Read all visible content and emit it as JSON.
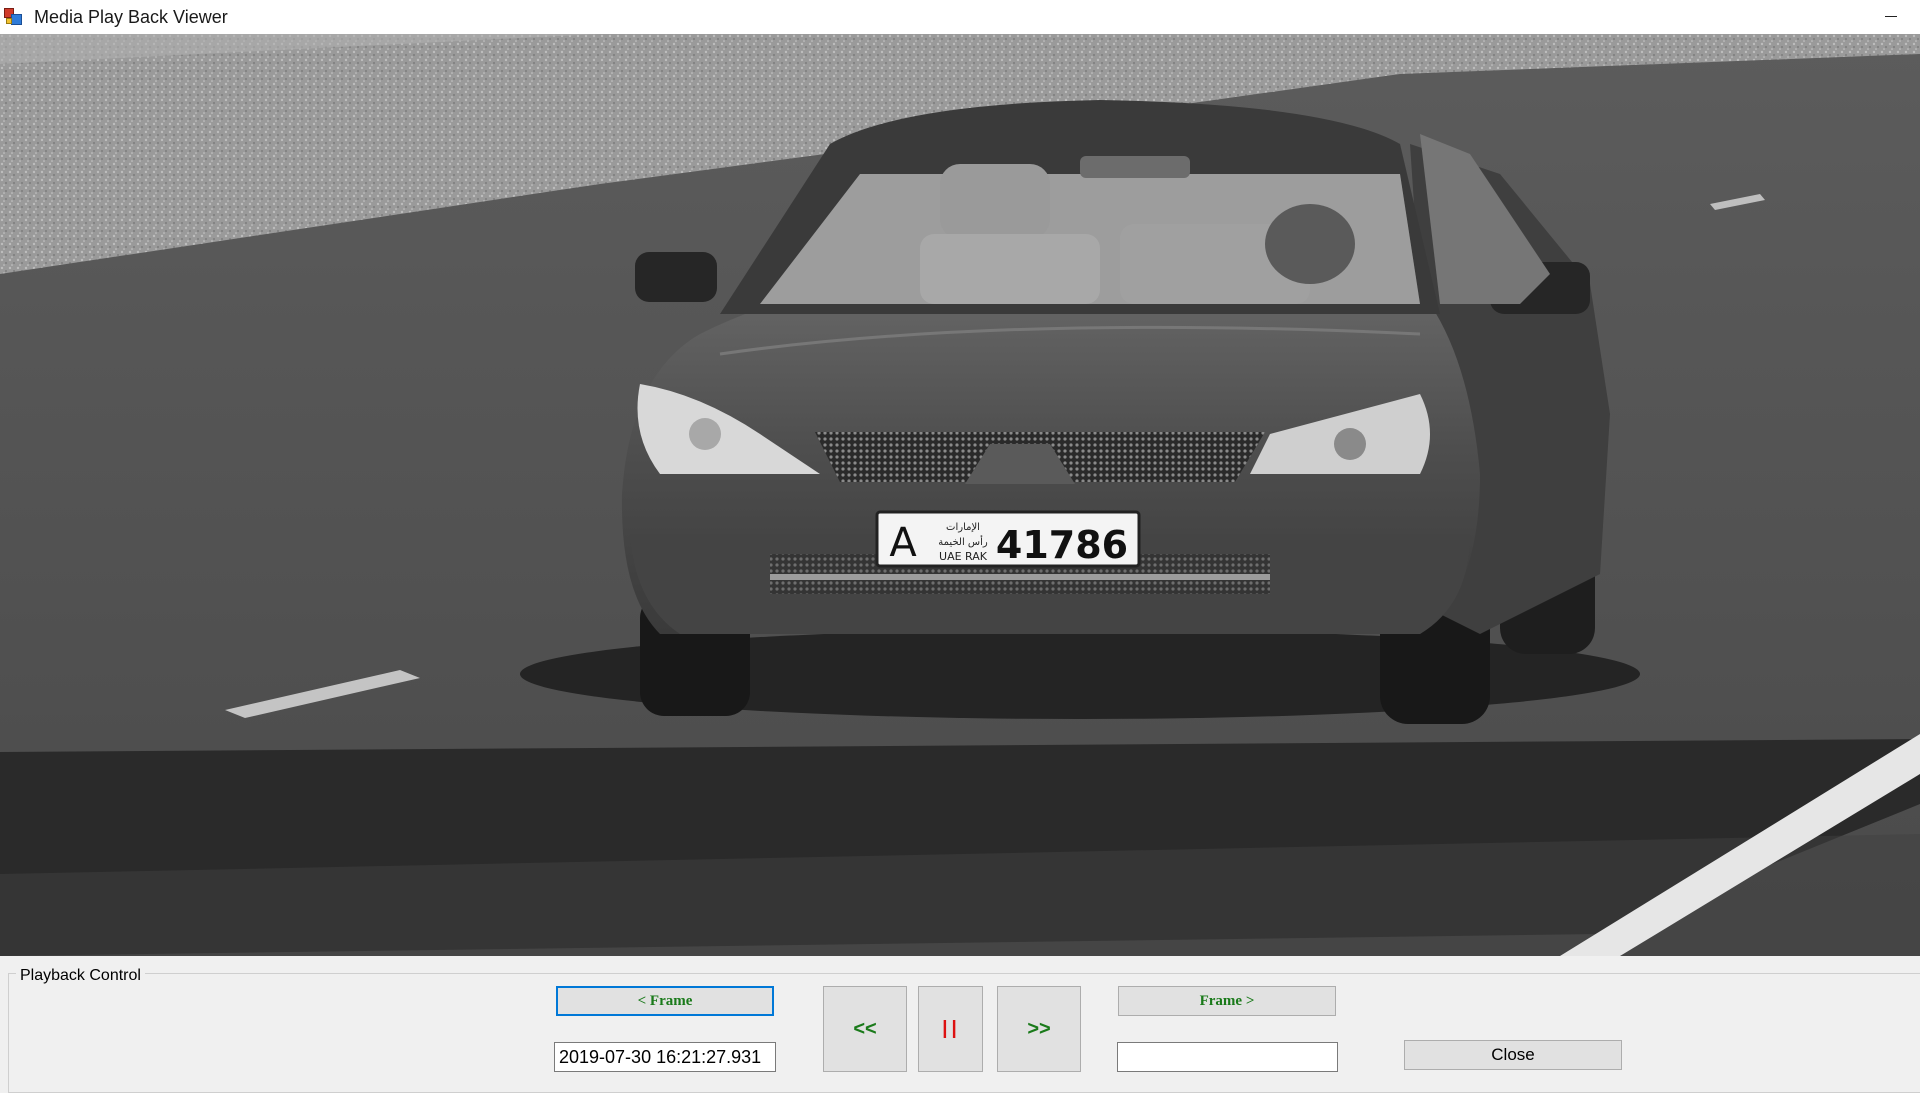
{
  "window": {
    "title": "Media Play Back Viewer",
    "icon": "media-app-icon"
  },
  "video": {
    "plate": {
      "letter": "A",
      "line1": "الإمارات",
      "line2": "رأس الخيمة",
      "line3": "UAE RAK",
      "number": "41786"
    }
  },
  "playback": {
    "group_label": "Playback Control",
    "prev_frame_label": "< Frame",
    "next_frame_label": "Frame >",
    "rewind_label": "<<",
    "pause_label": "II",
    "forward_label": ">>",
    "timestamp_value": "2019-07-30 16:21:27.931",
    "secondary_value": "",
    "close_label": "Close"
  }
}
